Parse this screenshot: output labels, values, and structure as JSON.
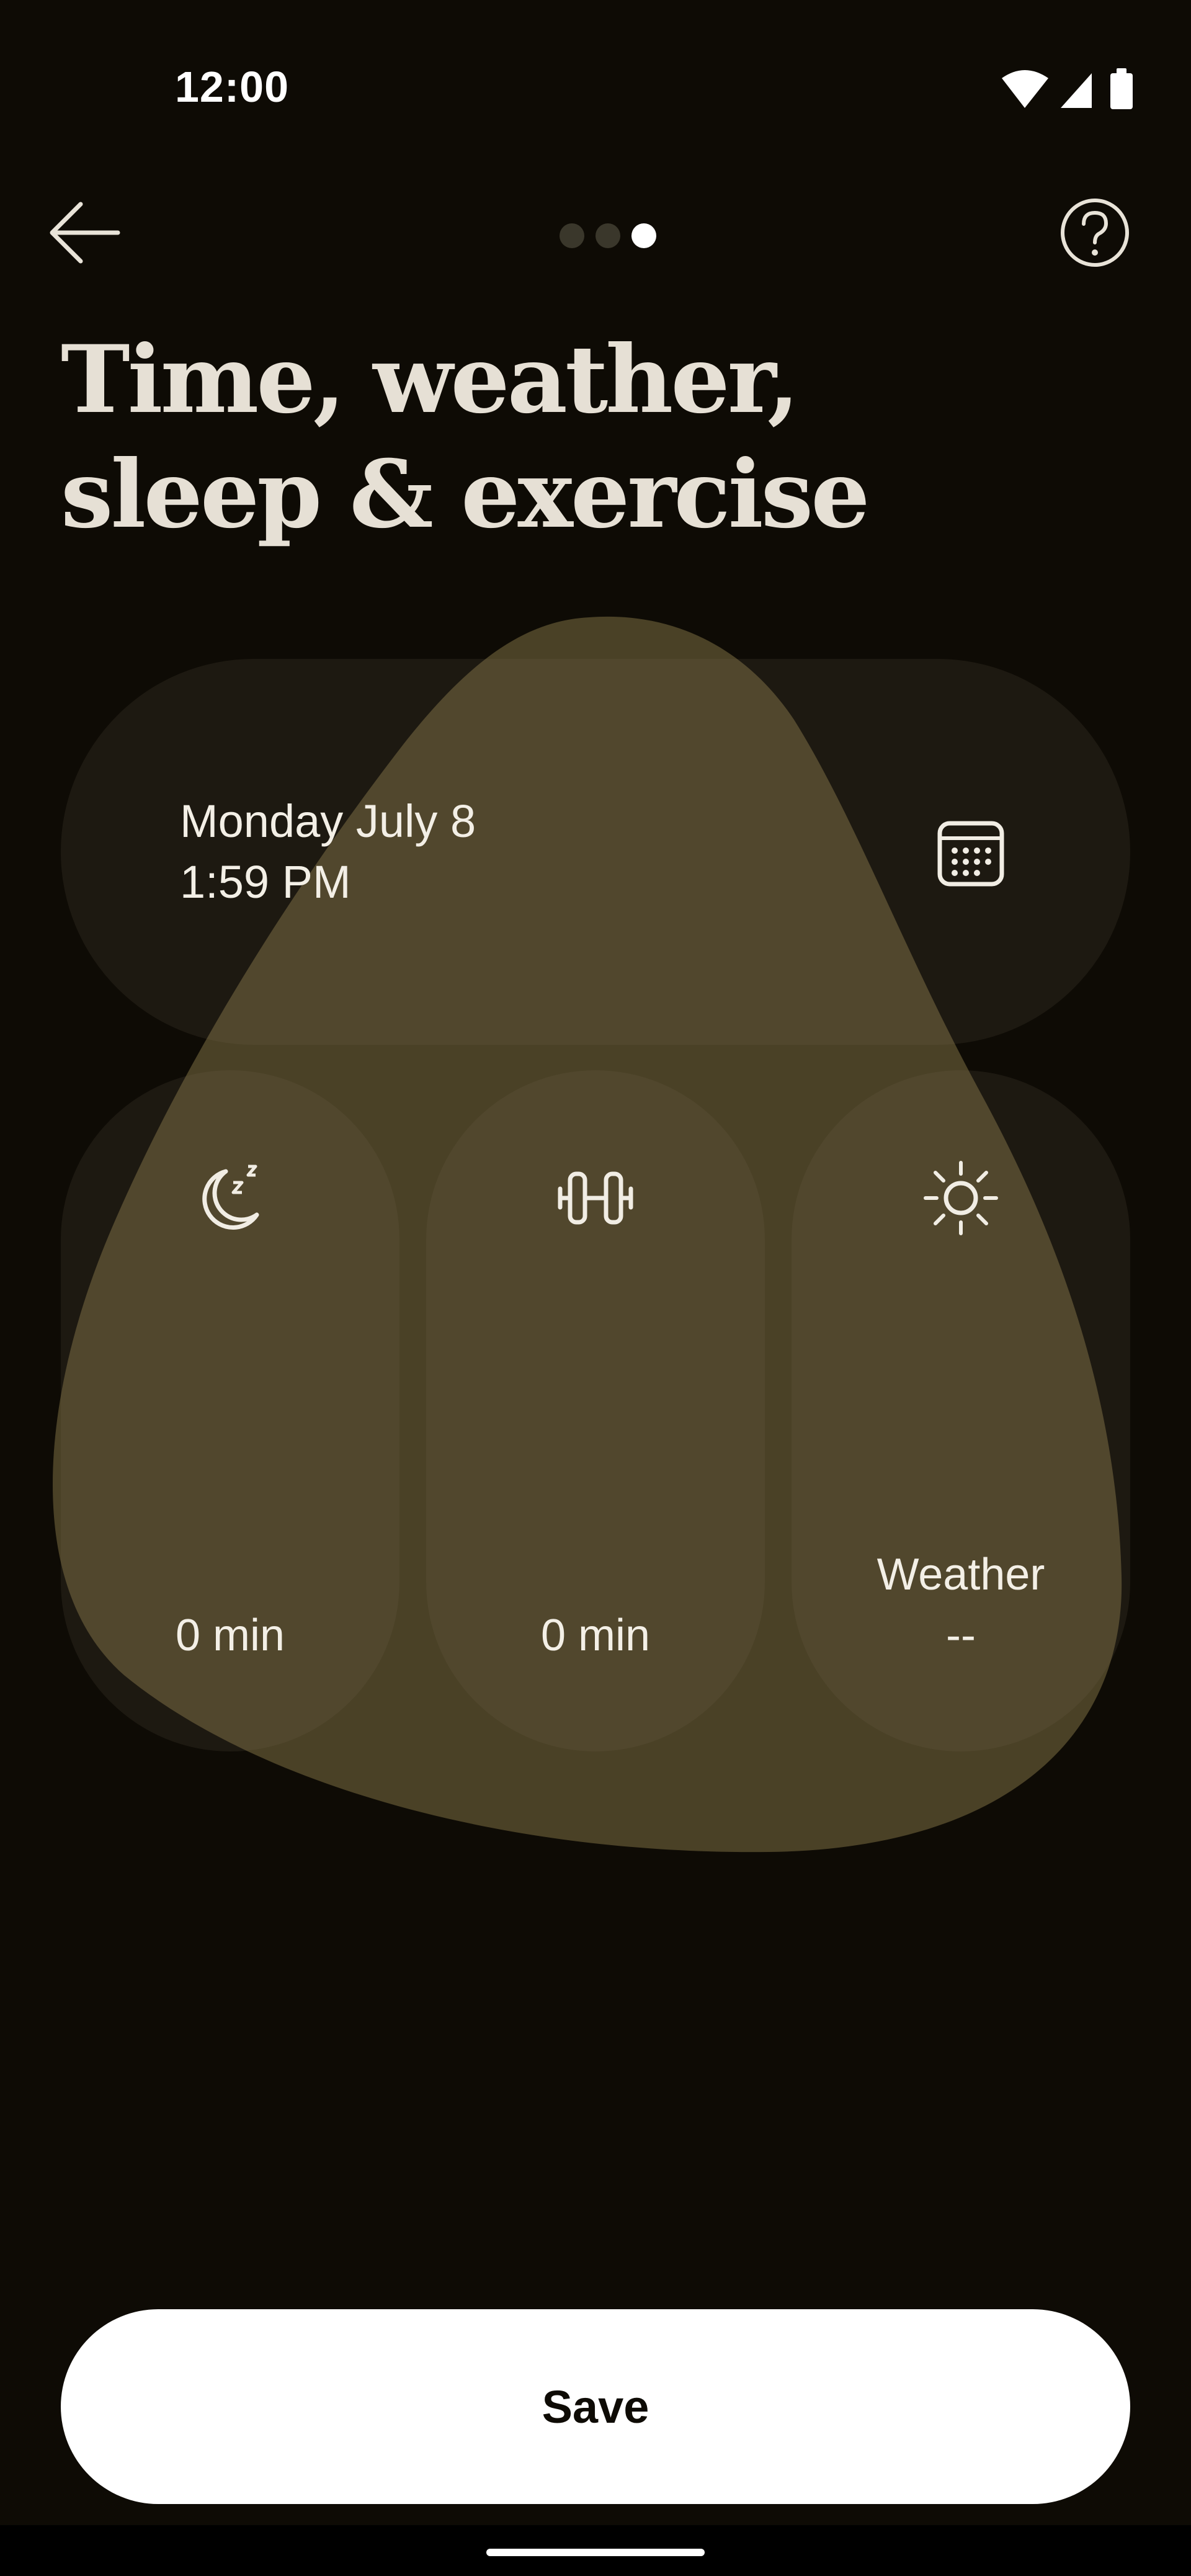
{
  "status_bar": {
    "time": "12:00",
    "icons": [
      "wifi-icon",
      "signal-icon",
      "battery-icon"
    ]
  },
  "top_bar": {
    "back_icon": "arrow-left-icon",
    "help_icon": "help-circle-icon",
    "pager": {
      "total": 3,
      "current": 3
    }
  },
  "title": {
    "line1": "Time, weather,",
    "line2": "sleep & exercise"
  },
  "datetime": {
    "date": "Monday July 8",
    "time": "1:59 PM",
    "icon": "calendar-icon"
  },
  "tiles": [
    {
      "id": "sleep",
      "icon": "moon-sleep-icon",
      "value": "0 min"
    },
    {
      "id": "exercise",
      "icon": "dumbbell-icon",
      "value": "0 min"
    },
    {
      "id": "weather",
      "icon": "sun-icon",
      "label": "Weather",
      "value": "--"
    }
  ],
  "save_label": "Save",
  "colors": {
    "background": "#0e0b05",
    "blob": "#4e4428",
    "card": "#1c1a14",
    "button": "#ffffff",
    "text": "#f1ede4"
  }
}
